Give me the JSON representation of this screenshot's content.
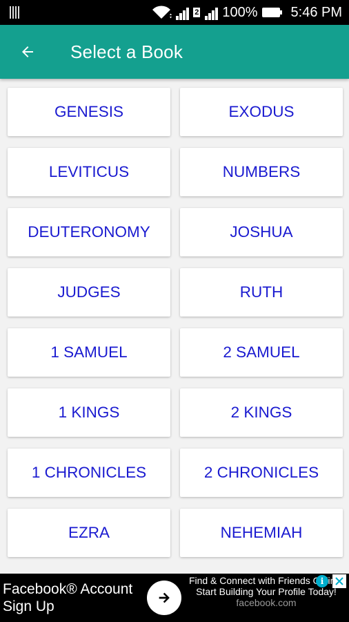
{
  "status_bar": {
    "sim_icon": "sim-card-icon",
    "wifi_icon": "wifi-icon",
    "signal_icon": "cell-signal-icon",
    "sim_badge": "2",
    "battery": "100%",
    "battery_icon": "battery-icon",
    "time": "5:46 PM"
  },
  "app_bar": {
    "back_icon": "back-arrow-icon",
    "title": "Select a Book",
    "color": "#14a08f"
  },
  "books": [
    "GENESIS",
    "EXODUS",
    "LEVITICUS",
    "NUMBERS",
    "DEUTERONOMY",
    "JOSHUA",
    "JUDGES",
    "RUTH",
    "1 SAMUEL",
    "2 SAMUEL",
    "1 KINGS",
    "2 KINGS",
    "1 CHRONICLES",
    "2 CHRONICLES",
    "EZRA",
    "NEHEMIAH"
  ],
  "book_text_color": "#1a1ad0",
  "ad": {
    "left_line1": "Facebook® Account",
    "left_line2": "Sign Up",
    "arrow_icon": "arrow-right-icon",
    "right_text": "Find & Connect with Friends Online. Start Building Your Profile Today!",
    "domain": "facebook.com",
    "info_icon": "info-icon",
    "close_icon": "close-icon"
  }
}
